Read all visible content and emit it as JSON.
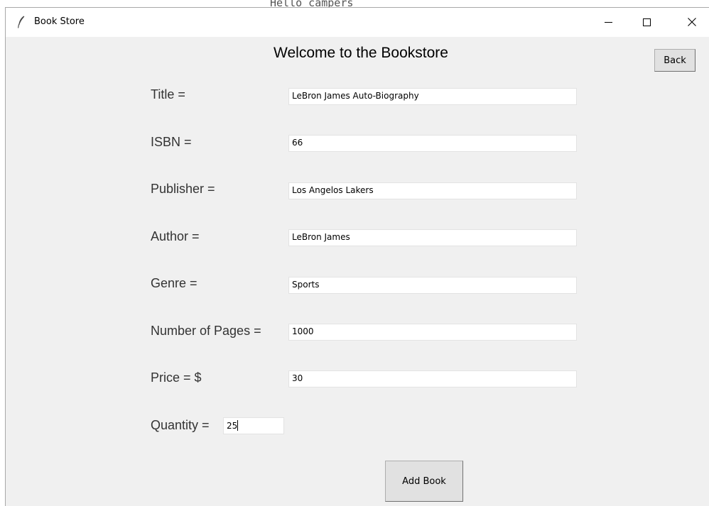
{
  "background_terminal_text": "Hello campers",
  "window": {
    "title": "Book Store",
    "icon": "feather-icon",
    "controls": {
      "minimize_icon": "minimize-icon",
      "maximize_icon": "maximize-icon",
      "close_icon": "close-icon"
    }
  },
  "header": {
    "title": "Welcome to the Bookstore",
    "back_label": "Back"
  },
  "form": {
    "fields": [
      {
        "label": "Title =",
        "value": "LeBron James Auto-Biography"
      },
      {
        "label": "ISBN =",
        "value": "66"
      },
      {
        "label": "Publisher =",
        "value": "Los Angelos Lakers"
      },
      {
        "label": "Author =",
        "value": "LeBron James"
      },
      {
        "label": "Genre =",
        "value": "Sports"
      },
      {
        "label": "Number of Pages =",
        "value": "1000"
      },
      {
        "label": "Price = $",
        "value": "30"
      },
      {
        "label": "Quantity =",
        "value": "25"
      }
    ],
    "submit_label": "Add Book"
  },
  "colors": {
    "window_background": "#f0f0f0",
    "titlebar_background": "#ffffff",
    "button_face": "#e1e1e1",
    "label_text": "#333333"
  }
}
